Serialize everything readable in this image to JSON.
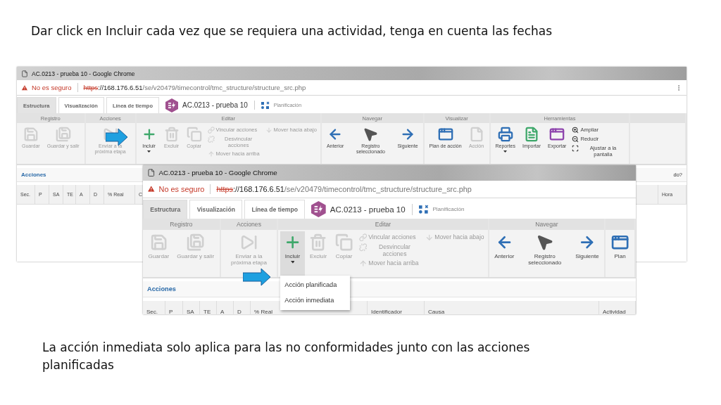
{
  "captions": {
    "top": "Dar click en Incluir cada vez que se requiera una actividad, tenga en cuenta las fechas",
    "bottom": "La acción inmediata solo aplica para las no conformidades junto con las acciones planificadas"
  },
  "back_window": {
    "title": "AC.0213 - prueba 10 - Google Chrome",
    "security": "No es seguro",
    "url": {
      "scheme": "https",
      "host": "://168.176.6.51",
      "path": "/se/v20479/timecontrol/tmc_structure/structure_src.php"
    },
    "tabs": [
      {
        "label": "Estructura",
        "selected": true
      },
      {
        "label": "Visualización",
        "selected": false
      },
      {
        "label": "Línea de tiempo",
        "selected": false
      }
    ],
    "record": "AC.0213 - prueba 10",
    "module": "Planificación",
    "ribbon": [
      {
        "title": "Registro",
        "large": [
          {
            "label": "Guardar",
            "disabled": true,
            "dropdown": false,
            "pressed": false
          },
          {
            "label": "Guardar y salir",
            "disabled": true,
            "dropdown": false,
            "pressed": false
          }
        ]
      },
      {
        "title": "Acciones",
        "large": [
          {
            "label": "Enviar a la próxima etapa",
            "disabled": true,
            "dropdown": false,
            "pressed": false
          }
        ]
      },
      {
        "title": "Editar",
        "large": [
          {
            "label": "Incluir",
            "disabled": false,
            "dropdown": true,
            "pressed": false
          },
          {
            "label": "Excluir",
            "disabled": true,
            "dropdown": false,
            "pressed": false
          },
          {
            "label": "Copiar",
            "disabled": true,
            "dropdown": false,
            "pressed": false
          }
        ],
        "small": [
          {
            "label": "Vincular acciones",
            "disabled": true
          },
          {
            "label": "Desvincular acciones",
            "disabled": true
          },
          {
            "label": "Mover hacia arriba",
            "disabled": true
          },
          {
            "label": "Mover hacia abajo",
            "disabled": true
          }
        ]
      },
      {
        "title": "Navegar",
        "large": [
          {
            "label": "Anterior",
            "disabled": false,
            "dropdown": false,
            "pressed": false
          },
          {
            "label": "Registro seleccionado",
            "disabled": false,
            "dropdown": false,
            "pressed": false
          },
          {
            "label": "Siguiente",
            "disabled": false,
            "dropdown": false,
            "pressed": false
          }
        ]
      },
      {
        "title": "Visualizar",
        "large": [
          {
            "label": "Plan de acción",
            "disabled": false,
            "dropdown": false,
            "pressed": false
          },
          {
            "label": "Acción",
            "disabled": true,
            "dropdown": false,
            "pressed": false
          }
        ]
      },
      {
        "title": "Herramientas",
        "large": [
          {
            "label": "Reportes",
            "disabled": false,
            "dropdown": true,
            "pressed": false
          },
          {
            "label": "Importar",
            "disabled": false,
            "dropdown": false,
            "pressed": false
          },
          {
            "label": "Exportar",
            "disabled": false,
            "dropdown": false,
            "pressed": false
          }
        ],
        "small": [
          {
            "label": "Ampliar",
            "disabled": false
          },
          {
            "label": "Reducir",
            "disabled": false
          },
          {
            "label": "Ajustar a la pantalla",
            "disabled": false
          }
        ]
      }
    ],
    "section": "Acciones",
    "note": "do?",
    "columns": [
      "Sec.",
      "P",
      "SA",
      "TE",
      "A",
      "D",
      "% Real",
      "C"
    ],
    "last_column": "Hora"
  },
  "front_window": {
    "title": "AC.0213 - prueba 10 - Google Chrome",
    "security": "No es seguro",
    "url": {
      "scheme": "https",
      "host": "://168.176.6.51",
      "path": "/se/v20479/timecontrol/tmc_structure/structure_src.php"
    },
    "tabs": [
      {
        "label": "Estructura",
        "selected": true
      },
      {
        "label": "Visualización",
        "selected": false
      },
      {
        "label": "Línea de tiempo",
        "selected": false
      }
    ],
    "record": "AC.0213 - prueba 10",
    "module": "Planificación",
    "ribbon": [
      {
        "title": "Registro",
        "large": [
          {
            "label": "Guardar",
            "disabled": true,
            "dropdown": false,
            "pressed": false
          },
          {
            "label": "Guardar y salir",
            "disabled": true,
            "dropdown": false,
            "pressed": false
          }
        ]
      },
      {
        "title": "Acciones",
        "large": [
          {
            "label": "Enviar a la próxima etapa",
            "disabled": true,
            "dropdown": false,
            "pressed": false
          }
        ]
      },
      {
        "title": "Editar",
        "large": [
          {
            "label": "Incluir",
            "disabled": false,
            "dropdown": true,
            "pressed": true
          },
          {
            "label": "Excluir",
            "disabled": true,
            "dropdown": false,
            "pressed": false
          },
          {
            "label": "Copiar",
            "disabled": true,
            "dropdown": false,
            "pressed": false
          }
        ],
        "small": [
          {
            "label": "Vincular acciones",
            "disabled": true
          },
          {
            "label": "Desvincular acciones",
            "disabled": true
          },
          {
            "label": "Mover hacia arriba",
            "disabled": true
          },
          {
            "label": "Mover hacia abajo",
            "disabled": true
          }
        ]
      },
      {
        "title": "Navegar",
        "large": [
          {
            "label": "Anterior",
            "disabled": false,
            "dropdown": false,
            "pressed": false
          },
          {
            "label": "Registro seleccionado",
            "disabled": false,
            "dropdown": false,
            "pressed": false
          },
          {
            "label": "Siguiente",
            "disabled": false,
            "dropdown": false,
            "pressed": false
          }
        ]
      },
      {
        "large": [
          {
            "label": "Plan",
            "disabled": false,
            "dropdown": false,
            "pressed": false
          }
        ]
      }
    ],
    "menu": [
      "Acción planificada",
      "Acción inmediata"
    ],
    "section": "Acciones",
    "columns": [
      "Sec.",
      "P",
      "SA",
      "TE",
      "A",
      "D",
      "% Real",
      "Identificador",
      "Causa",
      "Actividad"
    ]
  }
}
